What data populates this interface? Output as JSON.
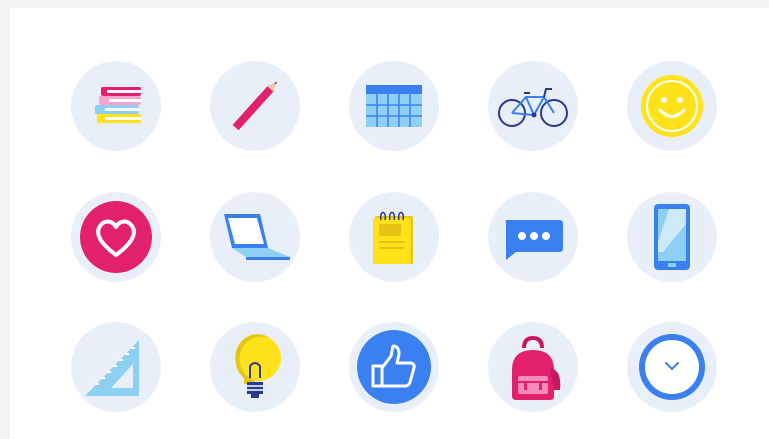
{
  "icons": [
    {
      "name": "books-icon"
    },
    {
      "name": "pencil-icon"
    },
    {
      "name": "calendar-icon"
    },
    {
      "name": "bicycle-icon"
    },
    {
      "name": "smiley-face-icon"
    },
    {
      "name": "heart-icon"
    },
    {
      "name": "laptop-icon"
    },
    {
      "name": "notepad-icon"
    },
    {
      "name": "chat-bubble-icon"
    },
    {
      "name": "smartphone-icon"
    },
    {
      "name": "set-square-ruler-icon"
    },
    {
      "name": "lightbulb-icon"
    },
    {
      "name": "thumbs-up-icon"
    },
    {
      "name": "backpack-icon"
    },
    {
      "name": "clock-icon"
    }
  ],
  "colors": {
    "circle_bg": "#e9eff9",
    "pink": "#e2206e",
    "yellow": "#ffe21a",
    "blue": "#3b80f0",
    "light_blue": "#8ed0f4",
    "navy": "#2b3a8c",
    "purple": "#6b2fa9"
  }
}
